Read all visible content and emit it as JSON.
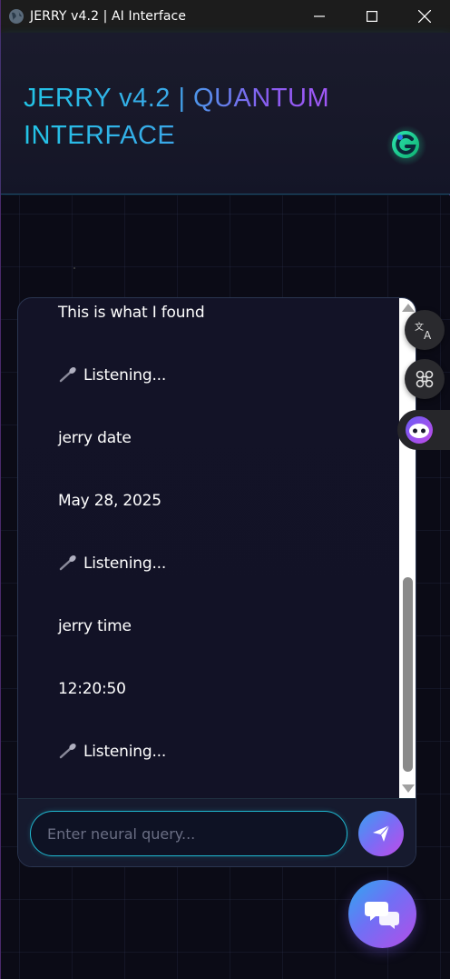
{
  "window": {
    "title": "JERRY v4.2 | AI Interface",
    "icons": {
      "app": "globe-icon",
      "minimize": "minimize-icon",
      "maximize": "maximize-icon",
      "close": "close-icon"
    }
  },
  "header": {
    "title": "JERRY v4.2 | QUANTUM INTERFACE",
    "logo_icon": "grammarly-g-logo",
    "accent_colors": [
      "#22c4e6",
      "#a855f7"
    ]
  },
  "chat": {
    "messages": [
      {
        "text": "This is what I found",
        "icon": null
      },
      {
        "text": "Listening...",
        "icon": "microphone-icon"
      },
      {
        "text": "jerry date",
        "icon": null
      },
      {
        "text": "May 28, 2025",
        "icon": null
      },
      {
        "text": "Listening...",
        "icon": "microphone-icon"
      },
      {
        "text": "jerry time",
        "icon": null
      },
      {
        "text": "12:20:50",
        "icon": null
      },
      {
        "text": "Listening...",
        "icon": "microphone-icon"
      }
    ],
    "input": {
      "value": "",
      "placeholder": "Enter neural query..."
    },
    "send_icon": "paper-plane-icon"
  },
  "side_tools": [
    {
      "name": "translate",
      "icon": "translate-icon"
    },
    {
      "name": "command",
      "icon": "command-icon"
    },
    {
      "name": "assistant",
      "icon": "bot-face-icon"
    }
  ],
  "fab": {
    "icon": "chat-bubbles-icon"
  },
  "colors": {
    "background": "#0b0b16",
    "panel": "#131327",
    "input_border": "#1fb8d0",
    "gradient_start": "#2ea8f0",
    "gradient_end": "#b44de8"
  }
}
